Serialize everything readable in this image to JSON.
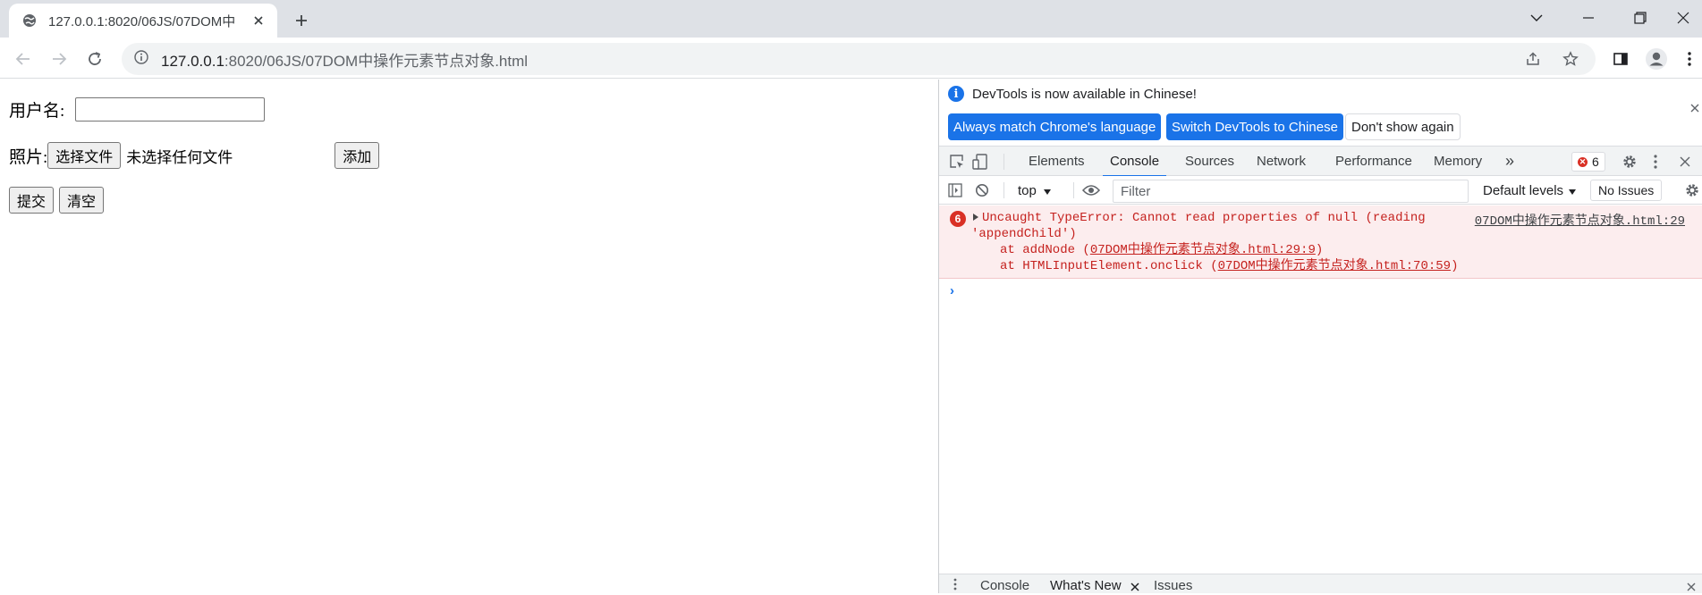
{
  "browser": {
    "tab": {
      "title": "127.0.0.1:8020/06JS/07DOM中",
      "favicon": "globe-icon"
    },
    "new_tab_icon": "plus-icon",
    "window_controls": [
      "chevron-down-icon",
      "minimize-icon",
      "restore-icon",
      "close-icon"
    ],
    "url_host": "127.0.0.1",
    "url_path": ":8020/06JS/07DOM中操作元素节点对象.html"
  },
  "page": {
    "username_label": "用户名:",
    "username_value": "",
    "photo_label": "照片:",
    "choose_file_button": "选择文件",
    "no_file_text": "未选择任何文件",
    "add_button": "添加",
    "submit_button": "提交",
    "clear_button": "清空"
  },
  "devtools": {
    "infobar": {
      "message": "DevTools is now available in Chinese!",
      "btn_match": "Always match Chrome's language",
      "btn_switch": "Switch DevTools to Chinese",
      "btn_dismiss": "Don't show again"
    },
    "tabs": [
      "Elements",
      "Console",
      "Sources",
      "Network",
      "Performance",
      "Memory"
    ],
    "more_tabs": "»",
    "error_count": "6",
    "console_toolbar": {
      "context": "top",
      "filter_placeholder": "Filter",
      "levels": "Default levels",
      "issues": "No Issues"
    },
    "error": {
      "count": "6",
      "message_line1": "Uncaught TypeError: Cannot read properties of null (reading",
      "message_line2": "'appendChild')",
      "source": "07DOM中操作元素节点对象.html:29",
      "stack1_prefix": "at addNode (",
      "stack1_link": "07DOM中操作元素节点对象.html:29:9",
      "stack1_suffix": ")",
      "stack2_prefix": "at HTMLInputElement.onclick (",
      "stack2_link": "07DOM中操作元素节点对象.html:70:59",
      "stack2_suffix": ")"
    },
    "prompt": "›",
    "drawer": {
      "console": "Console",
      "whats_new": "What's New",
      "issues": "Issues"
    },
    "colors": {
      "accent": "#1a73e8",
      "error": "#d93025",
      "error_bg": "#fcedee"
    }
  }
}
